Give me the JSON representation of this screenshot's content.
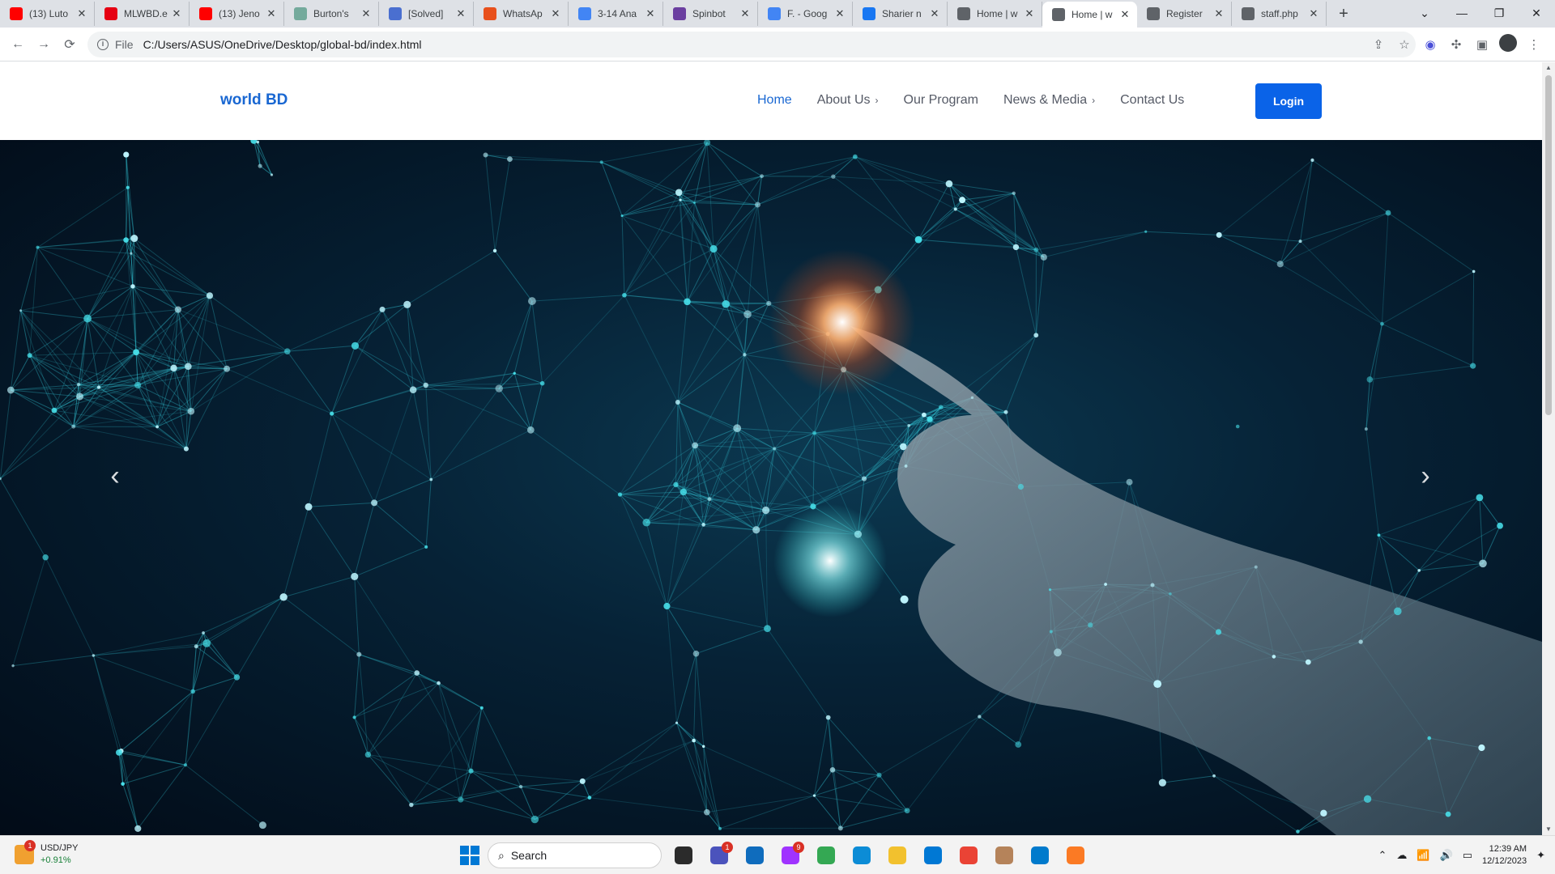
{
  "browser": {
    "tabs": [
      {
        "title": "(13) Luto",
        "color": "#ff0000"
      },
      {
        "title": "MLWBD.e",
        "color": "#e60012"
      },
      {
        "title": "(13) Jeno",
        "color": "#ff0000"
      },
      {
        "title": "Burton's",
        "color": "#74aa9c"
      },
      {
        "title": "[Solved]",
        "color": "#4a6fd0"
      },
      {
        "title": "WhatsAp",
        "color": "#e8501c"
      },
      {
        "title": "3-14 Ana",
        "color": "#4285f4"
      },
      {
        "title": "Spinbot",
        "color": "#6b3fa0"
      },
      {
        "title": "F. - Goog",
        "color": "#4285f4"
      },
      {
        "title": "Sharier n",
        "color": "#1877f2"
      },
      {
        "title": "Home | w",
        "color": "#5f6368"
      },
      {
        "title": "Home | w",
        "color": "#5f6368"
      },
      {
        "title": "Register",
        "color": "#5f6368"
      },
      {
        "title": "staff.php",
        "color": "#5f6368"
      }
    ],
    "active_tab_index": 11,
    "new_tab_label": "+",
    "window_controls": {
      "dropdown": "⌄",
      "minimize": "—",
      "restore": "❐",
      "close": "✕"
    },
    "nav": {
      "back": "←",
      "forward": "→",
      "reload": "⟳"
    },
    "address": {
      "scheme": "File",
      "url": "C:/Users/ASUS/OneDrive/Desktop/global-bd/index.html"
    },
    "toolbar_icons": [
      "share-icon",
      "star-icon",
      "extension-circle-icon",
      "puzzle-icon",
      "sidepanel-icon",
      "profile-icon",
      "menu-icon"
    ]
  },
  "site": {
    "brand": "world BD",
    "nav": [
      {
        "label": "Home",
        "active": true,
        "has_submenu": false
      },
      {
        "label": "About Us",
        "active": false,
        "has_submenu": true
      },
      {
        "label": "Our Program",
        "active": false,
        "has_submenu": false
      },
      {
        "label": "News & Media",
        "active": false,
        "has_submenu": true
      },
      {
        "label": "Contact Us",
        "active": false,
        "has_submenu": false
      }
    ],
    "login_label": "Login",
    "colors": {
      "brand": "#1967d2",
      "login_bg": "#0a63e8",
      "nav_text": "#555a66"
    },
    "hero": {
      "prev_arrow": "‹",
      "next_arrow": "›",
      "image_subject": "glowing network of nodes with a hand touching a light point"
    }
  },
  "taskbar": {
    "widget": {
      "ticker": "USD/JPY",
      "change": "+0.91%",
      "badge": "1"
    },
    "search_placeholder": "Search",
    "apps": [
      {
        "name": "file-explorer-taskview-icon",
        "color": "#2b2b2b",
        "badge": ""
      },
      {
        "name": "teams-icon",
        "color": "#4b53bc",
        "badge": "1"
      },
      {
        "name": "app-icon",
        "color": "#0f6cbd",
        "badge": ""
      },
      {
        "name": "messenger-icon",
        "color": "#a033ff",
        "badge": "9"
      },
      {
        "name": "chrome-icon",
        "color": "#34a853",
        "badge": ""
      },
      {
        "name": "edge-icon",
        "color": "#0c8cd6",
        "badge": ""
      },
      {
        "name": "folder-icon",
        "color": "#f2c12e",
        "badge": ""
      },
      {
        "name": "photos-icon",
        "color": "#0078d4",
        "badge": ""
      },
      {
        "name": "chrome-profile-icon",
        "color": "#ea4335",
        "badge": ""
      },
      {
        "name": "archive-icon",
        "color": "#b5835a",
        "badge": ""
      },
      {
        "name": "vscode-icon",
        "color": "#007acc",
        "badge": ""
      },
      {
        "name": "xampp-icon",
        "color": "#fb7a24",
        "badge": ""
      }
    ],
    "clock": {
      "time": "12:39 AM",
      "date": "12/12/2023"
    }
  }
}
